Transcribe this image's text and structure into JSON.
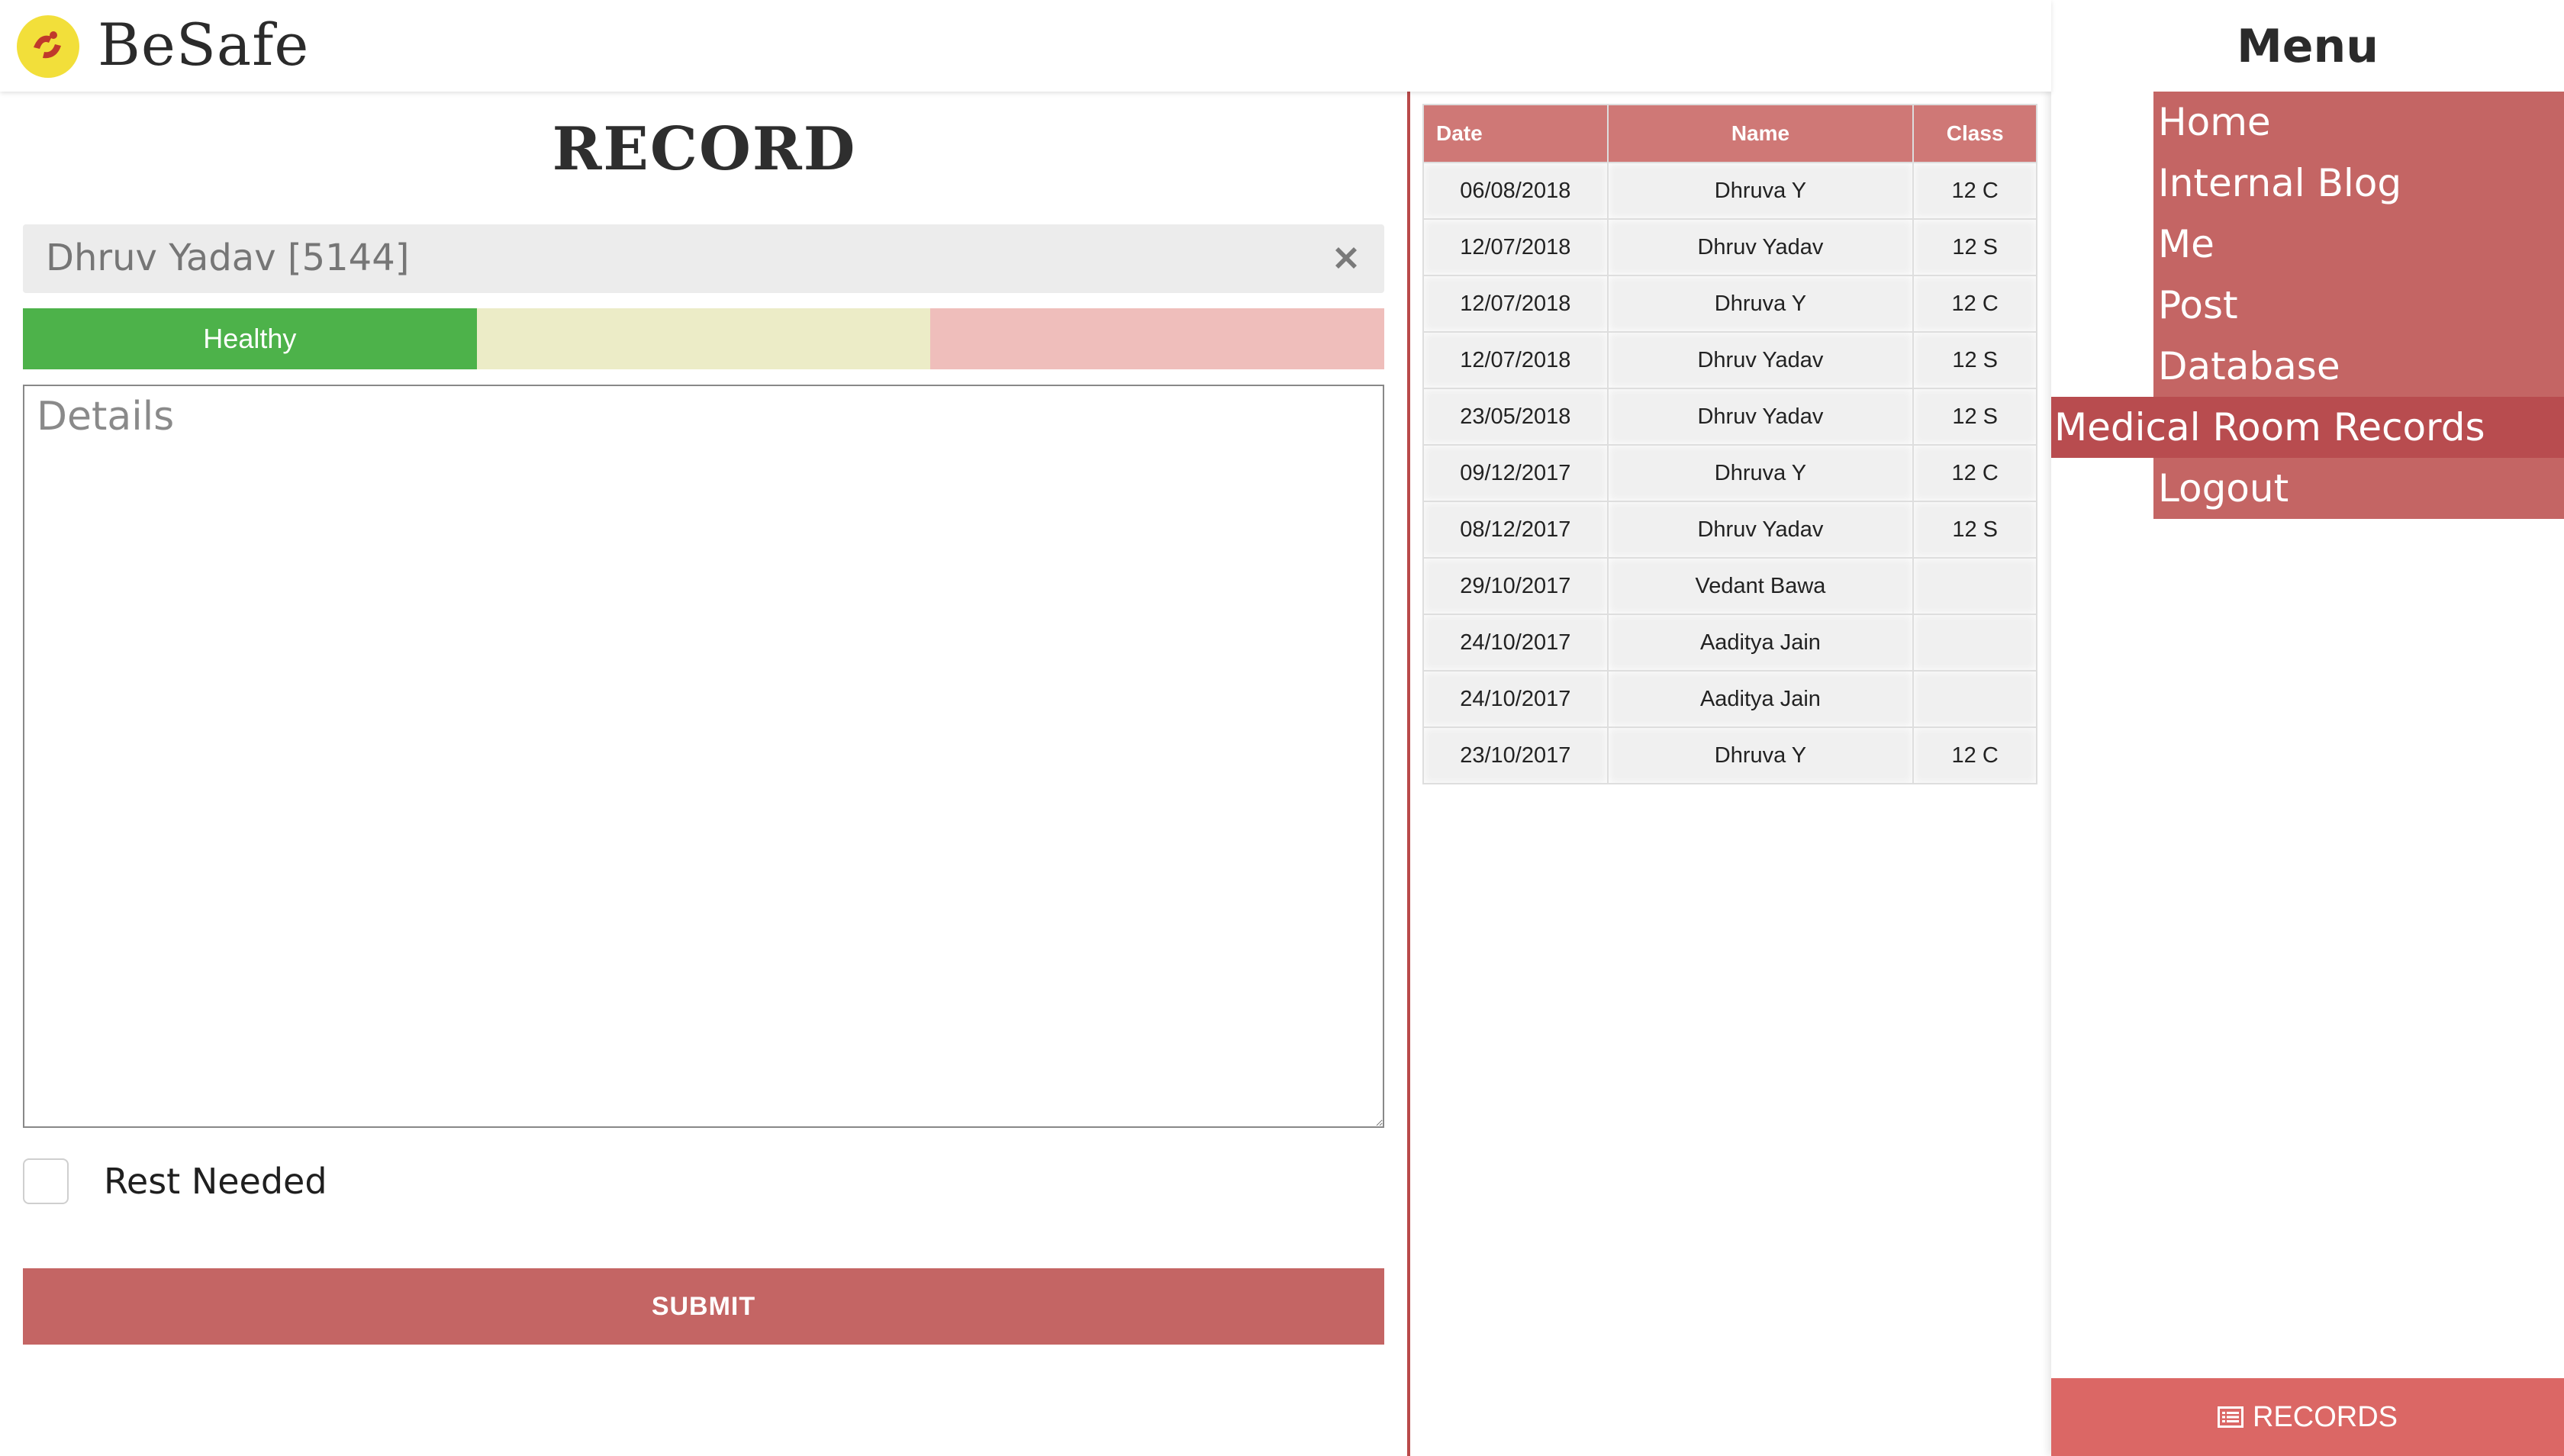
{
  "app": {
    "brand": "BeSafe"
  },
  "colors": {
    "accent": "#c46564",
    "healthy": "#4db24a",
    "table_header": "#cf7876",
    "divider": "#b94a4a"
  },
  "form": {
    "title": "RECORD",
    "patient_value": "Dhruv Yadav [5144]",
    "status_options": [
      "Healthy",
      "",
      ""
    ],
    "details_placeholder": "Details",
    "rest_label": "Rest Needed",
    "submit_label": "SUBMIT"
  },
  "records": {
    "columns": [
      "Date",
      "Name",
      "Class"
    ],
    "rows": [
      {
        "date": "06/08/2018",
        "name": "Dhruva Y",
        "class": "12 C"
      },
      {
        "date": "12/07/2018",
        "name": "Dhruv Yadav",
        "class": "12 S"
      },
      {
        "date": "12/07/2018",
        "name": "Dhruva Y",
        "class": "12 C"
      },
      {
        "date": "12/07/2018",
        "name": "Dhruv Yadav",
        "class": "12 S"
      },
      {
        "date": "23/05/2018",
        "name": "Dhruv Yadav",
        "class": "12 S"
      },
      {
        "date": "09/12/2017",
        "name": "Dhruva Y",
        "class": "12 C"
      },
      {
        "date": "08/12/2017",
        "name": "Dhruv Yadav",
        "class": "12 S"
      },
      {
        "date": "29/10/2017",
        "name": "Vedant Bawa",
        "class": ""
      },
      {
        "date": "24/10/2017",
        "name": "Aaditya Jain",
        "class": ""
      },
      {
        "date": "24/10/2017",
        "name": "Aaditya Jain",
        "class": ""
      },
      {
        "date": "23/10/2017",
        "name": "Dhruva Y",
        "class": "12 C"
      }
    ]
  },
  "menu": {
    "title": "Menu",
    "items": [
      "Home",
      "Internal Blog",
      "Me",
      "Post",
      "Database",
      "Medical Room Records",
      "Logout"
    ],
    "active_index": 5,
    "records_button": "RECORDS"
  }
}
